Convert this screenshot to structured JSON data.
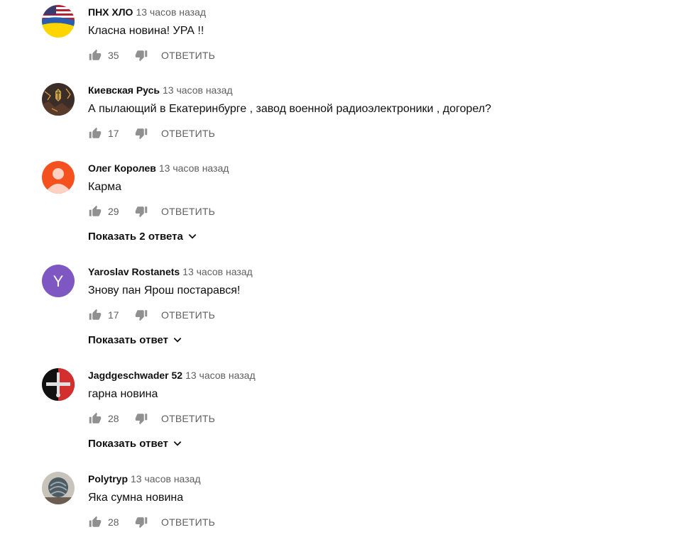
{
  "comments": [
    {
      "author": "ПНХ ХЛО",
      "time": "13 часов назад",
      "text": "Класна новина! УРА !!",
      "likes": "35",
      "reply_label": "ОТВЕТИТЬ"
    },
    {
      "author": "Киевская Русь",
      "time": "13 часов назад",
      "text": "А пылающий в Екатеринбурге , завод военной радиоэлектроники , догорел?",
      "likes": "17",
      "reply_label": "ОТВЕТИТЬ"
    },
    {
      "author": "Олег Королев",
      "time": "13 часов назад",
      "text": "Карма",
      "likes": "29",
      "reply_label": "ОТВЕТИТЬ",
      "replies_label": "Показать 2 ответа"
    },
    {
      "author": "Yaroslav Rostanets",
      "time": "13 часов назад",
      "text": "Знову пан Ярош постарався!",
      "likes": "17",
      "reply_label": "ОТВЕТИТЬ",
      "replies_label": "Показать ответ",
      "avatar_letter": "Y"
    },
    {
      "author": "Jagdgeschwader 52",
      "time": "13 часов назад",
      "text": "гарна новина",
      "likes": "28",
      "reply_label": "ОТВЕТИТЬ",
      "replies_label": "Показать ответ"
    },
    {
      "author": "Polytryp",
      "time": "13 часов назад",
      "text": "Яка сумна новина",
      "likes": "28",
      "reply_label": "ОТВЕТИТЬ"
    }
  ],
  "colors": {
    "avatar_default": "#f4511e",
    "avatar_letter_bg": "#7e57c2",
    "meta_gray": "#606060",
    "icon_gray": "#909090"
  },
  "icons": [
    "thumb-up-icon",
    "thumb-down-icon",
    "chevron-down-icon"
  ]
}
